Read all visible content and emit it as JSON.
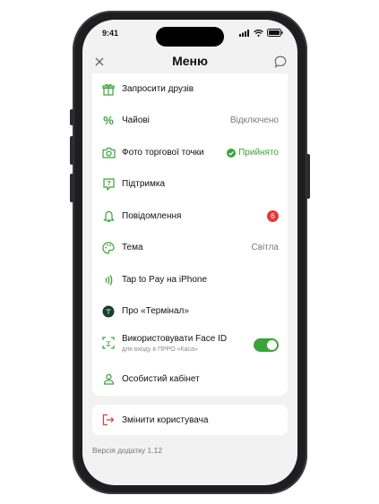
{
  "status_bar": {
    "time": "9:41"
  },
  "header": {
    "title": "Меню"
  },
  "menu": {
    "items": [
      {
        "label": "Запросити друзів",
        "icon": "gift-icon"
      },
      {
        "label": "Чайові",
        "value": "Відключено",
        "icon": "percent-icon"
      },
      {
        "label": "Фото торгової точки",
        "status": "Прийнято",
        "icon": "camera-icon"
      },
      {
        "label": "Підтримка",
        "icon": "help-icon"
      },
      {
        "label": "Повідомлення",
        "badge": "6",
        "icon": "bell-icon"
      },
      {
        "label": "Тема",
        "value": "Світла",
        "icon": "palette-icon"
      },
      {
        "label": "Tap to Pay на iPhone",
        "icon": "contactless-icon"
      },
      {
        "label": "Про «Термінал»",
        "icon": "terminal-logo-icon"
      },
      {
        "label": "Використовувати Face ID",
        "sublabel": "для входу в ПРРО «Касa»",
        "toggle_on": true,
        "icon": "face-id-icon"
      },
      {
        "label": "Особистий кабінет",
        "icon": "user-icon"
      }
    ]
  },
  "switch_user": {
    "label": "Змінити користувача",
    "icon": "logout-icon"
  },
  "version": "Версія додатку 1.12",
  "colors": {
    "accent": "#3aa33b",
    "danger": "#e53935"
  }
}
